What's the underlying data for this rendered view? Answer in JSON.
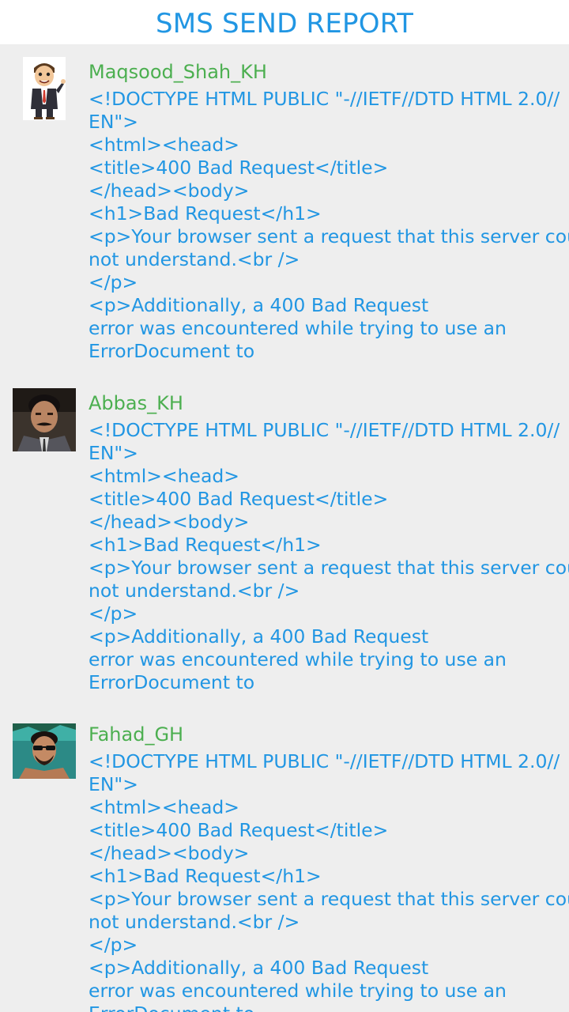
{
  "header": {
    "title": "SMS SEND REPORT"
  },
  "colors": {
    "accent": "#2196e3",
    "name": "#4caf50",
    "background": "#eeeeee",
    "header_bg": "#ffffff"
  },
  "items": [
    {
      "name": "Maqsood_Shah_KH",
      "avatar": "cartoon-businessman-avatar",
      "lines": [
        "<!DOCTYPE HTML PUBLIC \"-//IETF//DTD HTML 2.0//",
        "EN\">",
        "<html><head>",
        "<title>400 Bad Request</title>",
        "</head><body>",
        "<h1>Bad Request</h1>",
        "<p>Your browser sent a request that this server could",
        "not understand.<br />",
        "</p>",
        "<p>Additionally, a 400 Bad Request",
        "error was encountered while trying to use an",
        "ErrorDocument to"
      ]
    },
    {
      "name": "Abbas_KH",
      "avatar": "man-with-mustache-avatar",
      "lines": [
        "<!DOCTYPE HTML PUBLIC \"-//IETF//DTD HTML 2.0//",
        "EN\">",
        "<html><head>",
        "<title>400 Bad Request</title>",
        "</head><body>",
        "<h1>Bad Request</h1>",
        "<p>Your browser sent a request that this server could",
        "not understand.<br />",
        "</p>",
        "<p>Additionally, a 400 Bad Request",
        "error was encountered while trying to use an",
        "ErrorDocument to"
      ]
    },
    {
      "name": "Fahad_GH",
      "avatar": "man-with-sunglasses-avatar",
      "lines": [
        "<!DOCTYPE HTML PUBLIC \"-//IETF//DTD HTML 2.0//",
        "EN\">",
        "<html><head>",
        "<title>400 Bad Request</title>",
        "</head><body>",
        "<h1>Bad Request</h1>",
        "<p>Your browser sent a request that this server could",
        "not understand.<br />",
        "</p>",
        "<p>Additionally, a 400 Bad Request",
        "error was encountered while trying to use an",
        "ErrorDocument to"
      ]
    }
  ]
}
